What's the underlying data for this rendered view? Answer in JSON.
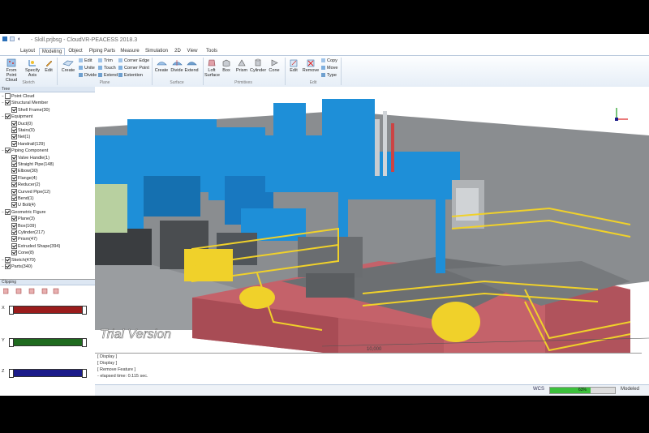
{
  "window": {
    "title": "- Skill.prjbsg - CloudVR-PEACESS 2018.3"
  },
  "tabs": [
    "Layout",
    "Modeling",
    "Object",
    "Piping Parts",
    "Measure",
    "Simulation",
    "2D",
    "View",
    "Tools"
  ],
  "active_tab": "Modeling",
  "ribbon": {
    "sketch": {
      "group_label": "Sketch",
      "from_point_cloud": "From Point Cloud",
      "specify_axis": "Specify Axis",
      "edit": "Edit"
    },
    "plane": {
      "group_label": "Plane",
      "create": "Create",
      "edit": "Edit",
      "unite": "Unite",
      "divide": "Divide",
      "trim": "Trim",
      "touch": "Touch",
      "extend": "Extend",
      "corner_edge": "Corner Edge",
      "corner_point": "Corner Point",
      "extention": "Extention"
    },
    "surface": {
      "group_label": "Surface",
      "create": "Create",
      "divide": "Divide",
      "extend": "Extend"
    },
    "primitives": {
      "group_label": "Primitives",
      "loft_surface": "Loft Surface",
      "box": "Box",
      "prism": "Prism",
      "cylinder": "Cylinder",
      "cone": "Cone"
    },
    "edit": {
      "group_label": "Edit",
      "edit": "Edit",
      "remove": "Remove",
      "copy": "Copy",
      "move": "Move",
      "type": "Type"
    }
  },
  "tree": {
    "header": "Tree",
    "items": [
      {
        "label": "Point Cloud",
        "level": 0,
        "checked": false
      },
      {
        "label": "Structural Member",
        "level": 0,
        "checked": true
      },
      {
        "label": "Shell Frame(30)",
        "level": 1,
        "checked": true
      },
      {
        "label": "Equipment",
        "level": 0,
        "checked": true
      },
      {
        "label": "Duct(0)",
        "level": 1,
        "checked": true
      },
      {
        "label": "Stairs(0)",
        "level": 1,
        "checked": true
      },
      {
        "label": "Net(1)",
        "level": 1,
        "checked": true
      },
      {
        "label": "Handrail(129)",
        "level": 1,
        "checked": true
      },
      {
        "label": "Piping Component",
        "level": 0,
        "checked": true
      },
      {
        "label": "Valve Handle(1)",
        "level": 1,
        "checked": true
      },
      {
        "label": "Straight Pipe(148)",
        "level": 1,
        "checked": true
      },
      {
        "label": "Elbow(30)",
        "level": 1,
        "checked": true
      },
      {
        "label": "Flange(4)",
        "level": 1,
        "checked": true
      },
      {
        "label": "Reducer(2)",
        "level": 1,
        "checked": true
      },
      {
        "label": "Curved Pipe(12)",
        "level": 1,
        "checked": true
      },
      {
        "label": "Bend(1)",
        "level": 1,
        "checked": true
      },
      {
        "label": "U Bolt(4)",
        "level": 1,
        "checked": true
      },
      {
        "label": "Geometric Figure",
        "level": 0,
        "checked": true
      },
      {
        "label": "Plane(3)",
        "level": 1,
        "checked": true
      },
      {
        "label": "Box(109)",
        "level": 1,
        "checked": true
      },
      {
        "label": "Cylinder(217)",
        "level": 1,
        "checked": true
      },
      {
        "label": "Prism(47)",
        "level": 1,
        "checked": true
      },
      {
        "label": "Extruded Shape(394)",
        "level": 1,
        "checked": true
      },
      {
        "label": "Cone(8)",
        "level": 1,
        "checked": true
      },
      {
        "label": "Sketch(470)",
        "level": 0,
        "checked": true
      },
      {
        "label": "Parts(340)",
        "level": 0,
        "checked": true
      }
    ]
  },
  "clipping": {
    "header": "Clipping",
    "axes": [
      {
        "label": "X",
        "color": "#9a1c1c"
      },
      {
        "label": "Y",
        "color": "#1f6b1f"
      },
      {
        "label": "Z",
        "color": "#1c1c8a"
      }
    ]
  },
  "viewport": {
    "watermark": "Trial Version",
    "dimension": "10,000"
  },
  "console": {
    "lines": [
      "[ Display ]",
      "[ Display ]",
      "[ Remove Feature ]",
      "- elapsed time: 0.115 sec."
    ]
  },
  "status": {
    "coord_system": "WCS",
    "progress_text": "63%",
    "progress": 0.63,
    "mode": "Modeled"
  },
  "colors": {
    "structure_blue": "#1e8fd8",
    "handrail_yellow": "#f0d12a",
    "base_red": "#c4626a",
    "floor_gray": "#8a8d90"
  }
}
